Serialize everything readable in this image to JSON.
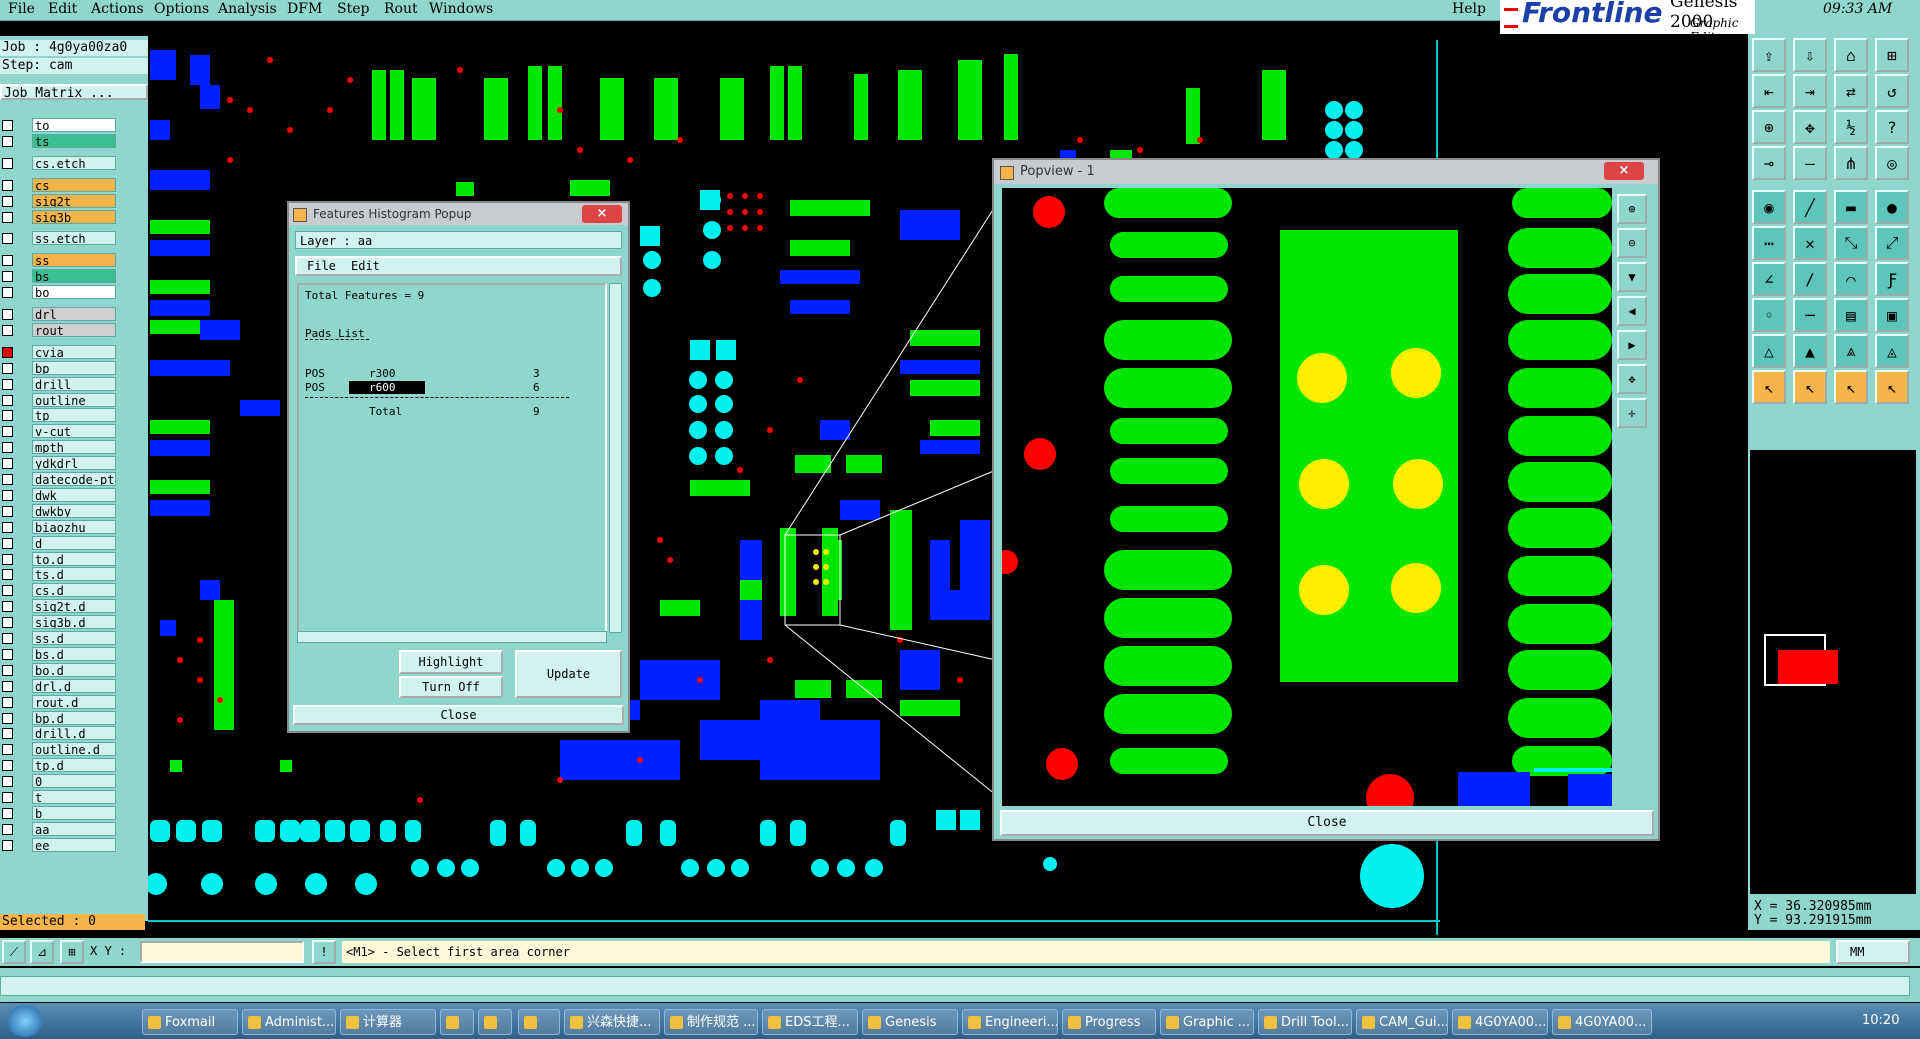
{
  "menubar": {
    "items": [
      "File",
      "Edit",
      "Actions",
      "Options",
      "Analysis",
      "DFM",
      "Step",
      "Rout",
      "Windows"
    ],
    "help": "Help"
  },
  "brand": {
    "logo": "Frontline",
    "product": "Genesis 2000",
    "subtitle": "Graphic Editor"
  },
  "clock": "09:33 AM",
  "job": {
    "job_label": "Job : 4g0ya00za0",
    "step_label": "Step: cam",
    "matrix_button": "Job Matrix ..."
  },
  "layers": [
    {
      "name": "to",
      "style": "white"
    },
    {
      "name": "ts",
      "style": "green"
    },
    {
      "name": "cs.etch",
      "style": "plain"
    },
    {
      "name": "cs",
      "style": "orange"
    },
    {
      "name": "sig2t",
      "style": "orange"
    },
    {
      "name": "sig3b",
      "style": "orange"
    },
    {
      "name": "ss.etch",
      "style": "plain"
    },
    {
      "name": "ss",
      "style": "orange"
    },
    {
      "name": "bs",
      "style": "green"
    },
    {
      "name": "bo",
      "style": "white"
    },
    {
      "name": "drl",
      "style": "grey"
    },
    {
      "name": "rout",
      "style": "grey"
    },
    {
      "name": "cvia",
      "style": "plain"
    },
    {
      "name": "bp",
      "style": "plain"
    },
    {
      "name": "drill",
      "style": "plain"
    },
    {
      "name": "outline",
      "style": "plain"
    },
    {
      "name": "tp",
      "style": "plain"
    },
    {
      "name": "v-cut",
      "style": "plain"
    },
    {
      "name": "mpth",
      "style": "plain"
    },
    {
      "name": "ydkdrl",
      "style": "plain"
    },
    {
      "name": "datecode-pt",
      "style": "plain"
    },
    {
      "name": "dwk",
      "style": "plain"
    },
    {
      "name": "dwkby",
      "style": "plain"
    },
    {
      "name": "biaozhu",
      "style": "plain"
    },
    {
      "name": "d",
      "style": "plain"
    },
    {
      "name": "to.d",
      "style": "plain"
    },
    {
      "name": "ts.d",
      "style": "plain"
    },
    {
      "name": "cs.d",
      "style": "plain"
    },
    {
      "name": "sig2t.d",
      "style": "plain"
    },
    {
      "name": "sig3b.d",
      "style": "plain"
    },
    {
      "name": "ss.d",
      "style": "plain"
    },
    {
      "name": "bs.d",
      "style": "plain"
    },
    {
      "name": "bo.d",
      "style": "plain"
    },
    {
      "name": "drl.d",
      "style": "plain"
    },
    {
      "name": "rout.d",
      "style": "plain"
    },
    {
      "name": "bp.d",
      "style": "plain"
    },
    {
      "name": "drill.d",
      "style": "plain"
    },
    {
      "name": "outline.d",
      "style": "plain"
    },
    {
      "name": "tp.d",
      "style": "plain"
    },
    {
      "name": "0",
      "style": "plain"
    },
    {
      "name": "t",
      "style": "plain"
    },
    {
      "name": "b",
      "style": "plain"
    },
    {
      "name": "aa",
      "style": "plain"
    },
    {
      "name": "ee",
      "style": "plain"
    }
  ],
  "selected": "Selected : 0",
  "histogram": {
    "title": "Features Histogram Popup",
    "layer": "Layer :  aa",
    "menu": [
      "File",
      "Edit"
    ],
    "total_features": "Total Features = 9",
    "pads_list": "Pads List",
    "rows": [
      {
        "type": "POS",
        "symbol": "r300",
        "count": "3"
      },
      {
        "type": "POS",
        "symbol": "r600",
        "count": "6"
      }
    ],
    "total_label": "Total",
    "total_value": "9",
    "buttons": {
      "highlight": "Highlight",
      "turn_off": "Turn Off",
      "update": "Update",
      "close": "Close"
    }
  },
  "popview": {
    "title": "Popview - 1",
    "close": "Close"
  },
  "coords": {
    "x": "X = 36.320985mm",
    "y": "Y = 93.291915mm"
  },
  "cmdbar": {
    "xy_label": "X Y :",
    "prompt": "<M1> - Select first area corner",
    "units": "MM"
  },
  "taskbar": {
    "items": [
      "Foxmail",
      "Administ...",
      "计算器",
      "",
      "",
      "",
      "兴森快捷...",
      "制作规范 ...",
      "EDS工程...",
      "Genesis",
      "Engineeri...",
      "Progress",
      "Graphic ...",
      "Drill Tool...",
      "CAM_Gui...",
      "4G0YA00...",
      "4G0YA00..."
    ],
    "time": "10:20"
  },
  "colors": {
    "panel": "#8fd6cf",
    "pad_green": "#00e600",
    "pad_blue": "#0020ff",
    "pad_cyan": "#00f0f0",
    "pad_red": "#ff0000",
    "pad_yellow": "#ffee00",
    "highlight_orange": "#f7b44a"
  }
}
